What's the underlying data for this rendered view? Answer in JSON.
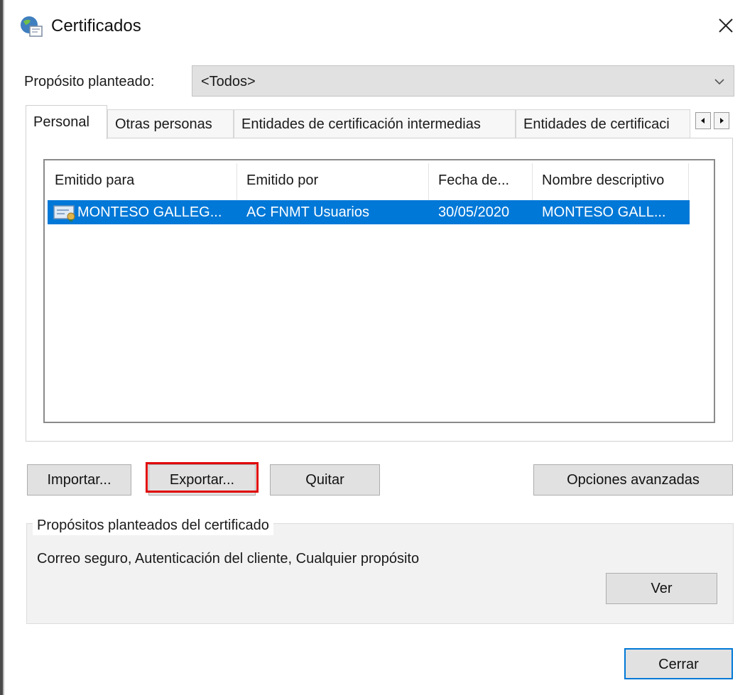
{
  "window": {
    "title": "Certificados",
    "app_icon": "certificate-globe-icon",
    "close_icon": "close-icon"
  },
  "purpose": {
    "label": "Propósito planteado:",
    "selected": "<Todos>"
  },
  "tabs": [
    {
      "label": "Personal",
      "active": true
    },
    {
      "label": "Otras personas",
      "active": false
    },
    {
      "label": "Entidades de certificación intermedias",
      "active": false
    },
    {
      "label": "Entidades de certificaci",
      "active": false
    }
  ],
  "certificates": {
    "columns": [
      "Emitido para",
      "Emitido por",
      "Fecha de...",
      "Nombre descriptivo"
    ],
    "rows": [
      {
        "issued_to": "MONTESO GALLEG...",
        "issued_by": "AC FNMT Usuarios",
        "date": "30/05/2020",
        "friendly_name": "MONTESO GALL...",
        "selected": true
      }
    ]
  },
  "buttons": {
    "import": "Importar...",
    "export": "Exportar...",
    "remove": "Quitar",
    "advanced": "Opciones avanzadas",
    "view": "Ver",
    "close": "Cerrar"
  },
  "purposes_group": {
    "title": "Propósitos planteados del certificado",
    "text": "Correo seguro, Autenticación del cliente, Cualquier propósito"
  },
  "colors": {
    "selection": "#0078d7",
    "highlight_border": "#e00000",
    "button_face": "#e1e1e1"
  }
}
